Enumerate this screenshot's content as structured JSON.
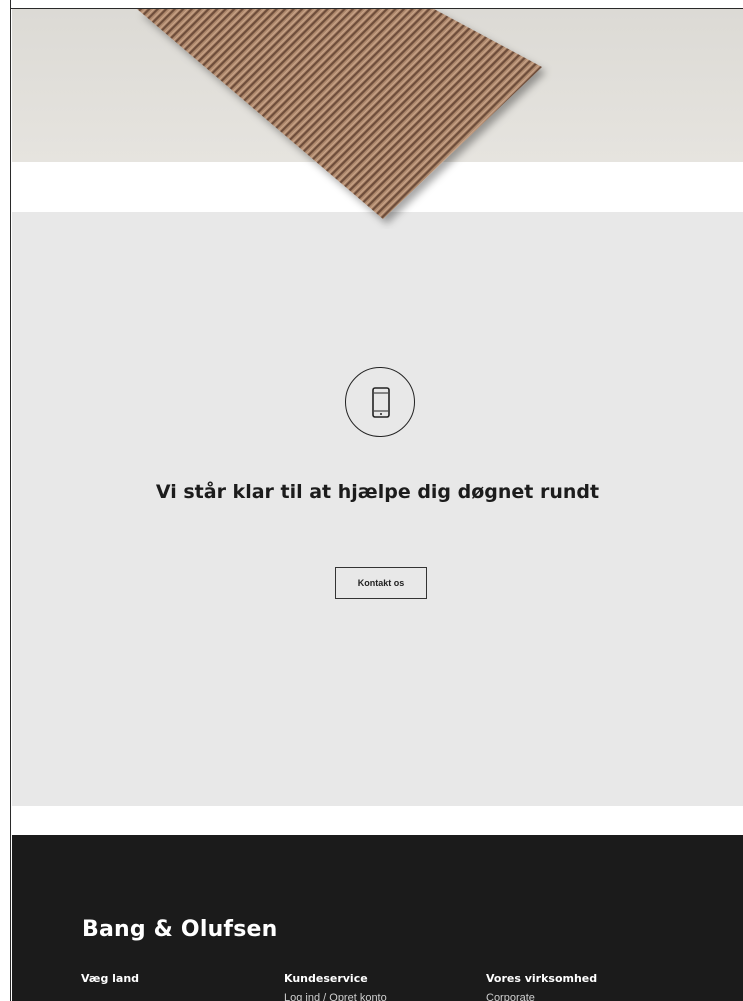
{
  "contact": {
    "headline": "Vi står klar til at hjælpe dig døgnet rundt",
    "button_label": "Kontakt os",
    "icon": "phone-icon"
  },
  "footer": {
    "brand": "Bang & Olufsen",
    "columns": [
      {
        "heading": "Væg land",
        "links": [
          ""
        ]
      },
      {
        "heading": "Kundeservice",
        "links": [
          "Log ind / Opret konto"
        ]
      },
      {
        "heading": "Vores virksomhed",
        "links": [
          "Corporate"
        ]
      }
    ]
  },
  "colors": {
    "contact_background": "#e8e8e8",
    "footer_background": "#1b1b1b",
    "hero_background": "#dcdad5"
  }
}
